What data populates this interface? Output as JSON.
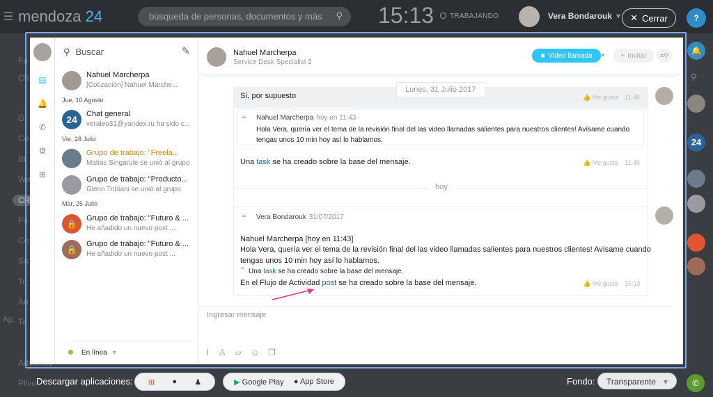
{
  "app": {
    "logo_main": "mendoza",
    "logo_num": "24"
  },
  "topbar": {
    "search_placeholder": "búsqueda de personas, documentos y más",
    "clock": "15:13",
    "work_status": "TRABAJANDO",
    "user_name": "Vera Bondarouk",
    "close_label": "Cerrar",
    "help_label": "?"
  },
  "background_menu": [
    "Fu",
    "Ch",
    "Gr",
    "Co",
    "Bt",
    "We",
    "CR",
    "Fu",
    "Co",
    "Sa",
    "Te",
    "Au",
    "Te",
    "Ad",
    "Ap",
    "Plivo"
  ],
  "background_menu_tail": "ciones",
  "list": {
    "search_label": "Buscar",
    "items": [
      {
        "title": "Nahuel Marcherpa",
        "subtitle": "[Cotización] Nahuel Marche...",
        "color": "#a09a94"
      },
      {
        "title": "Chat general",
        "subtitle": "veraleo31@yandex.ru ha sido c...",
        "color": "#2a6496",
        "badge": "24"
      },
      {
        "title": "Grupo de trabajo: \"Freela...",
        "subtitle": "Matias Singarule se unió al grupo",
        "color": "#6a7b8c"
      },
      {
        "title": "Grupo de trabajo: \"Producto...",
        "subtitle": "Glenn Tribiani se unió al grupo",
        "color": "#9b9aa0"
      },
      {
        "title": "Grupo de trabajo: \"Futuro & ...",
        "subtitle": "He añadido un nuevo post ...",
        "color": "#e0552f"
      },
      {
        "title": "Grupo de trabajo: \"Futuro & ...",
        "subtitle": "He añadido un nuevo post ...",
        "color": "#a06a58"
      }
    ],
    "days": [
      "Jue, 10 Agosto",
      "Vie, 28 Julio",
      "Mar, 25 Julio"
    ],
    "status": "En línea"
  },
  "chat": {
    "name": "Nahuel Marcherpa",
    "role": "Service Desk Specialist 2",
    "video_label": "Video llamada",
    "invite_label": "Invitar",
    "date_divider": "Lunes, 31 Julio 2017",
    "msg1_text": "Sí, por supuesto",
    "like": "Me gusta",
    "time1": "11:48",
    "quote1_author": "Nahuel Marcherpa",
    "quote1_time": "hoy en 11:43",
    "quote1_line1": "Hola Vera, quería ver el tema de la revisión final del las video llamadas salientes para nuestros clientes! Avísame cuando",
    "quote1_line2": "tengas unos 10 min hoy así lo hablamos.",
    "task_pre": "Una",
    "task_link": "task",
    "task_post": "se ha creado sobre la base del mensaje.",
    "time2": "11:48",
    "today": "hoy",
    "quote2_author": "Vera Bondarouk",
    "quote2_date": "31/07/2017",
    "msg2_line1": "Nahuel Marcherpa [hoy en 11:43]",
    "msg2_line2": "Hola Vera, quería ver el tema de la revisión final del las video llamadas salientes para nuestros clientes! Avísame cuando",
    "msg2_line3": "tengas unos 10 min hoy así lo hablamos.",
    "flow_pre": "En el Flujo de Actividad",
    "flow_link": "post",
    "flow_post": "se ha creado sobre la base del mensaje.",
    "time3": "15:10",
    "input_placeholder": "Ingresar mensaje"
  },
  "bottom": {
    "download_label": "Descargar aplicaciones:",
    "google_play": "Google Play",
    "app_store": "App Store",
    "fondo_label": "Fondo:",
    "fondo_value": "Transparente"
  }
}
